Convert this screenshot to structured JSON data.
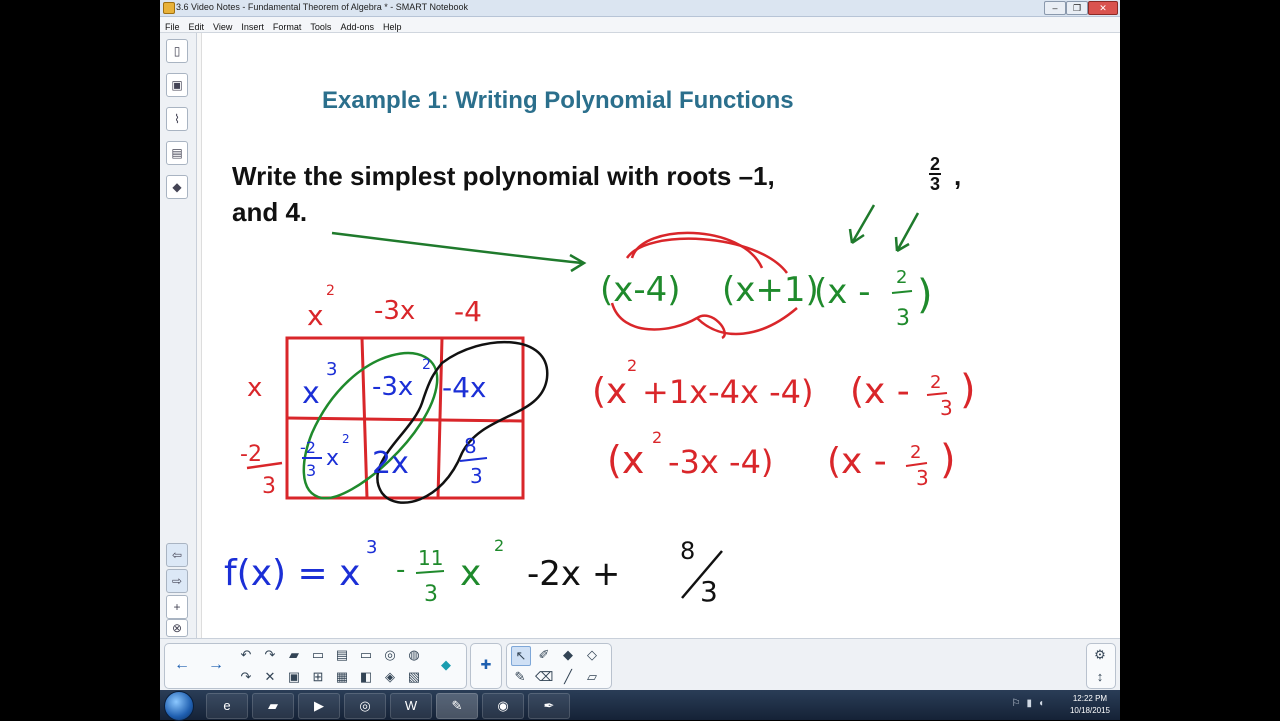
{
  "window": {
    "title": "3.6 Video Notes - Fundamental Theorem of Algebra * - SMART Notebook",
    "minimize": "–",
    "restore": "❐",
    "close": "✕"
  },
  "menu": [
    "File",
    "Edit",
    "View",
    "Insert",
    "Format",
    "Tools",
    "Add-ons",
    "Help"
  ],
  "slide": {
    "heading": "Example 1: Writing Polynomial Functions",
    "prompt_line1": "Write the simplest polynomial with roots –1,",
    "frac_num": "2",
    "frac_den": "3",
    "comma": ",",
    "prompt_line2": "and 4."
  },
  "handwriting": {
    "box_top": [
      "x",
      "2",
      "-3x",
      "-4"
    ],
    "box_left": [
      "x",
      "-2",
      "3"
    ],
    "cells": [
      "x",
      "3",
      "-3x",
      "2",
      "-4x",
      "-2",
      "3",
      "x",
      "2",
      "2x",
      "8",
      "3"
    ],
    "factors": [
      "(x-4)",
      "(x+1)",
      "(x -",
      "2",
      "3",
      ")"
    ],
    "step1": [
      "(x",
      "2",
      "+1x-4x -4)",
      "(x -",
      "2",
      "3",
      ")"
    ],
    "step2": [
      "(x",
      "2",
      "-3x -4)",
      "(x -",
      "2",
      "3",
      ")"
    ],
    "answer": [
      "f(x) = x",
      "3",
      "-",
      "11",
      "3",
      "x",
      "2",
      "-2x +",
      "8",
      "3"
    ]
  },
  "taskbar": {
    "time": "12:22 PM",
    "date": "10/18/2015"
  },
  "colors": {
    "heading": "#2b6f8c",
    "ink_red": "#d9262a",
    "ink_blue": "#1b2fd6",
    "ink_green": "#1f8a2c",
    "ink_black": "#111111"
  }
}
